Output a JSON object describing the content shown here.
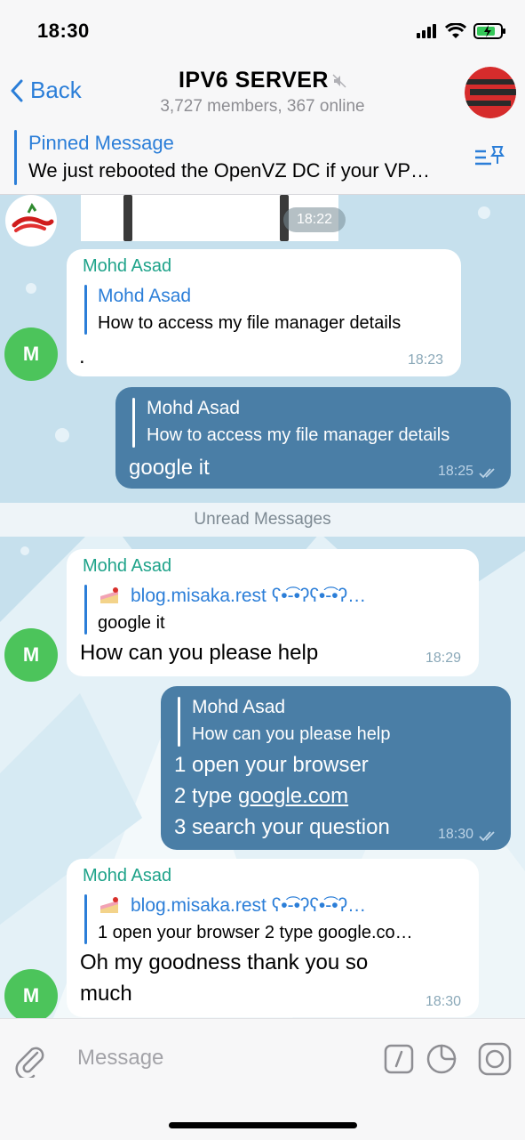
{
  "status": {
    "time": "18:30"
  },
  "header": {
    "back_label": "Back",
    "title": "IPV6 SERVER",
    "subtitle": "3,727 members, 367 online"
  },
  "pinned": {
    "title": "Pinned Message",
    "text": "We just rebooted the OpenVZ DC if your VP…"
  },
  "messages": [
    {
      "time": "18:22"
    },
    {
      "sender": "Mohd Asad",
      "reply_name": "Mohd Asad",
      "reply_text": "How to access my file manager details",
      "text": ".",
      "time": "18:23",
      "avatar": "M"
    },
    {
      "reply_name": "Mohd Asad",
      "reply_text": "How to access my file manager details",
      "text": "google it",
      "time": "18:25"
    },
    {
      "sender": "Mohd Asad",
      "reply_name": "blog.misaka.rest ʕ•͡-•ʔʕ•͡-•ʔ…",
      "reply_text": "google it",
      "text": "How can you please help",
      "time": "18:29",
      "avatar": "M"
    },
    {
      "reply_name": "Mohd Asad",
      "reply_text": "How can you please help",
      "line1": "1 open your browser",
      "line2_prefix": "2 type ",
      "line2_link": "google.com",
      "line3": "3 search your question",
      "time": "18:30"
    },
    {
      "sender": "Mohd Asad",
      "reply_name": "blog.misaka.rest ʕ•͡-•ʔʕ•͡-•ʔ…",
      "reply_text": "1 open your browser 2 type google.co…",
      "line1": "Oh my goodness thank you so",
      "line2": "much",
      "time": "18:30",
      "avatar": "M"
    }
  ],
  "unread_label": "Unread Messages",
  "composer": {
    "placeholder": "Message"
  },
  "colors": {
    "accent": "#2b7ed8",
    "outgoing": "#4a7ea6",
    "sender": "#1fa38a",
    "avatar": "#4cc45b"
  }
}
